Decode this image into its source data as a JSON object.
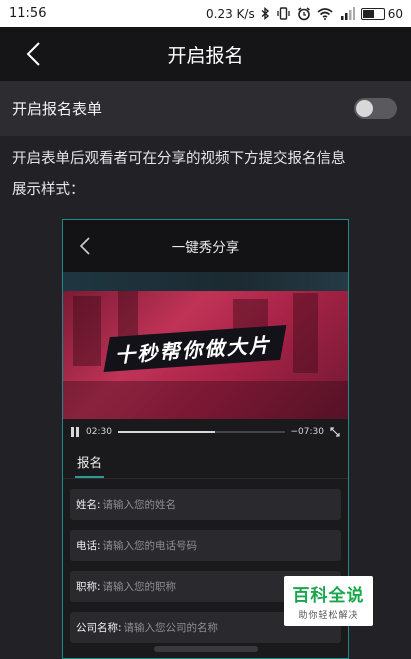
{
  "status_bar": {
    "time": "11:56",
    "speed": "0.23 K/s",
    "battery": "60",
    "battery_level": 0.6,
    "icons": [
      "bluetooth-icon",
      "vibrate-icon",
      "alarm-icon",
      "wifi-icon",
      "signal-icon",
      "battery-icon"
    ]
  },
  "nav": {
    "title": "开启报名",
    "back_icon": "chevron-left-icon"
  },
  "toggle": {
    "label": "开启报名表单",
    "state": "off"
  },
  "description": {
    "line1": "开启表单后观看者可在分享的视频下方提交报名信息",
    "line2": "展示样式："
  },
  "preview": {
    "title": "一键秀分享",
    "video_caption": "十秒帮你做大片",
    "time_elapsed": "02:30",
    "time_remaining": "−07:30",
    "progress": 0.58,
    "form_tab": "报名",
    "fields": [
      {
        "label": "姓名:",
        "placeholder": "请输入您的姓名"
      },
      {
        "label": "电话:",
        "placeholder": "请输入您的电话号码"
      },
      {
        "label": "职称:",
        "placeholder": "请输入您的职称"
      },
      {
        "label": "公司名称:",
        "placeholder": "请输入您公司的名称"
      }
    ]
  },
  "watermark": {
    "title": "百科全说",
    "subtitle": "助你轻松解决"
  },
  "colors": {
    "accent": "#1f8a88",
    "tab_underline": "#2f9a8f",
    "watermark_green": "#1aa64b"
  }
}
